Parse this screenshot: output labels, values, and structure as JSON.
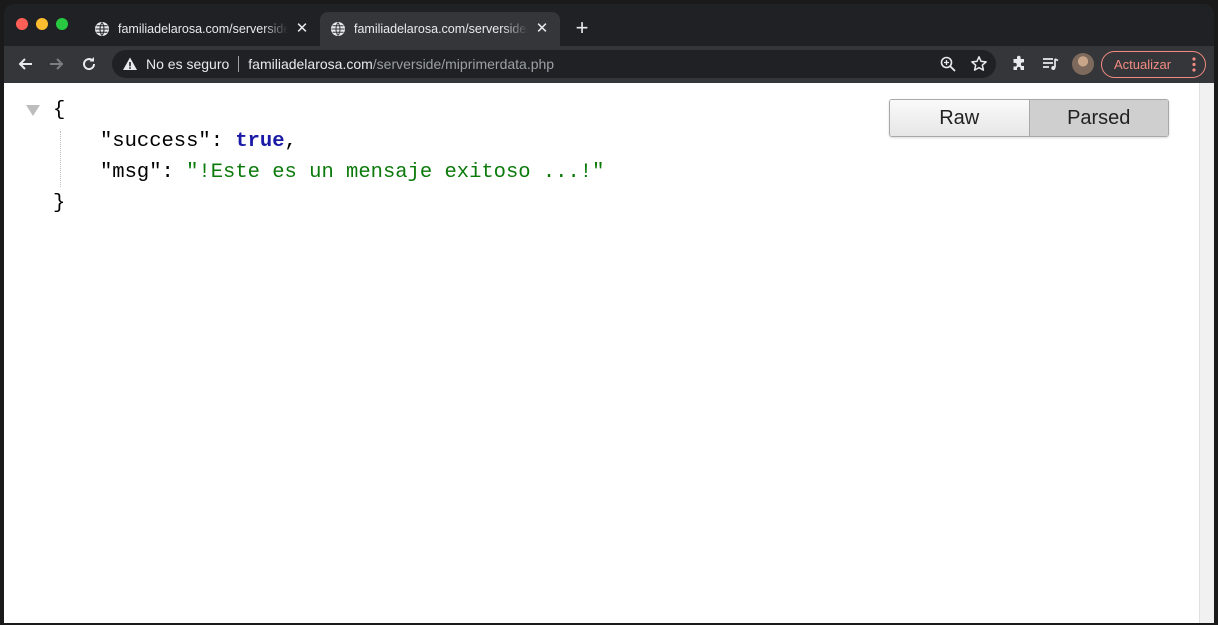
{
  "tabs": [
    {
      "title": "familiadelarosa.com/serverside/miprimerdata.php",
      "active": false
    },
    {
      "title": "familiadelarosa.com/serverside/miprimerdata.php",
      "active": true
    }
  ],
  "toolbar": {
    "security_label": "No es seguro",
    "url_host": "familiadelarosa.com",
    "url_path": "/serverside/miprimerdata.php",
    "update_label": "Actualizar"
  },
  "json_view": {
    "open_brace": "{",
    "close_brace": "}",
    "entries": [
      {
        "key": "\"success\"",
        "colon": ": ",
        "value": "true",
        "comma": ","
      },
      {
        "key": "\"msg\"",
        "colon": ": ",
        "value": "\"!Este es un mensaje exitoso ...!\"",
        "comma": ""
      }
    ]
  },
  "view_toggle": {
    "raw_label": "Raw",
    "parsed_label": "Parsed",
    "selected": "Parsed"
  },
  "colors": {
    "accent_update": "#f28b82",
    "json_bool": "#1a1aa6",
    "json_string": "#0b7a0b"
  },
  "icons": [
    "globe-icon",
    "close-icon",
    "plus-icon",
    "back-arrow-icon",
    "forward-arrow-icon",
    "reload-icon",
    "warning-icon",
    "zoom-icon",
    "star-icon",
    "extensions-icon",
    "media-queue-icon",
    "avatar",
    "menu-dots-icon"
  ]
}
